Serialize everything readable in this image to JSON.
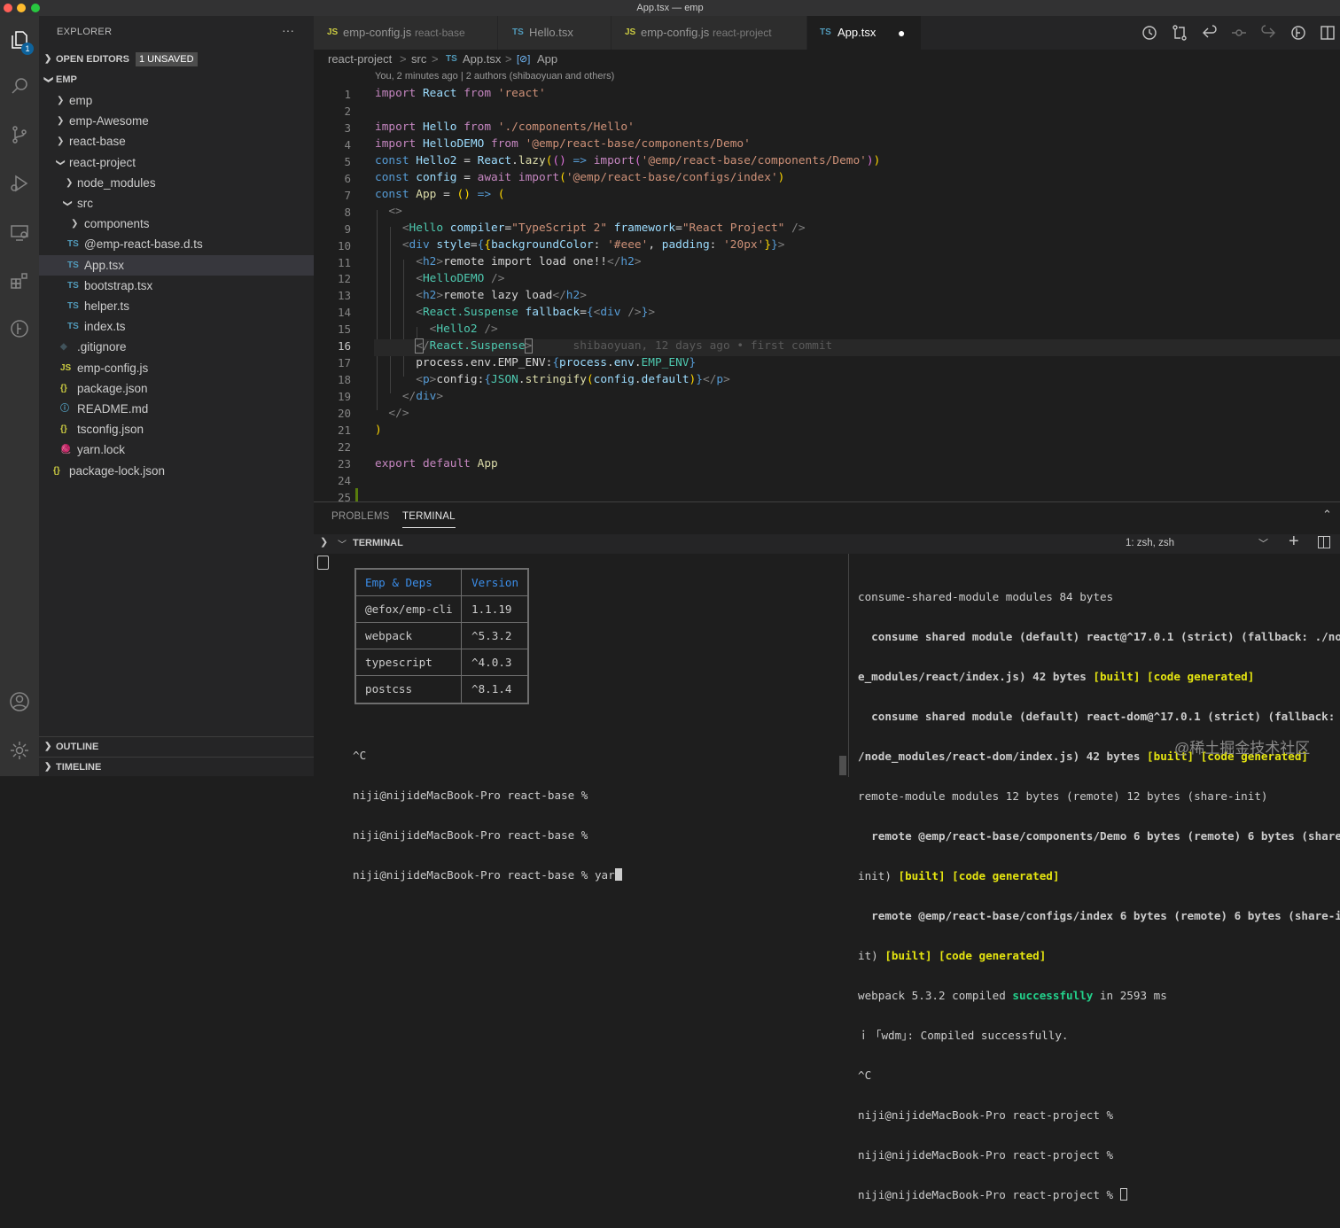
{
  "window": {
    "title": "App.tsx — emp"
  },
  "activity_bar": {
    "explorer_badge": "1"
  },
  "sidebar": {
    "title": "EXPLORER",
    "more": "···",
    "open_editors": {
      "label": "OPEN EDITORS",
      "badge": "1 UNSAVED"
    },
    "root": "EMP",
    "tree": [
      {
        "name": "emp",
        "icon": "",
        "kind": "folder",
        "expanded": false
      },
      {
        "name": "emp-Awesome",
        "icon": "",
        "kind": "folder",
        "expanded": false
      },
      {
        "name": "react-base",
        "icon": "",
        "kind": "folder",
        "expanded": false
      },
      {
        "name": "react-project",
        "icon": "",
        "kind": "folder",
        "expanded": true
      },
      {
        "name": "node_modules",
        "icon": "",
        "kind": "folder",
        "expanded": false
      },
      {
        "name": "src",
        "icon": "",
        "kind": "folder",
        "expanded": true
      },
      {
        "name": "components",
        "icon": "",
        "kind": "folder",
        "expanded": false
      },
      {
        "name": "@emp-react-base.d.ts",
        "icon": "TS",
        "kind": "ts"
      },
      {
        "name": "App.tsx",
        "icon": "TS",
        "kind": "ts",
        "selected": true
      },
      {
        "name": "bootstrap.tsx",
        "icon": "TS",
        "kind": "ts"
      },
      {
        "name": "helper.ts",
        "icon": "TS",
        "kind": "ts"
      },
      {
        "name": "index.ts",
        "icon": "TS",
        "kind": "ts"
      },
      {
        "name": ".gitignore",
        "icon": "◆",
        "kind": "git"
      },
      {
        "name": "emp-config.js",
        "icon": "JS",
        "kind": "js"
      },
      {
        "name": "package.json",
        "icon": "{}",
        "kind": "json"
      },
      {
        "name": "README.md",
        "icon": "ⓘ",
        "kind": "info"
      },
      {
        "name": "tsconfig.json",
        "icon": "{}",
        "kind": "json"
      },
      {
        "name": "yarn.lock",
        "icon": "🧶",
        "kind": "yarn"
      },
      {
        "name": "package-lock.json",
        "icon": "{}",
        "kind": "json"
      }
    ],
    "outline": "OUTLINE",
    "timeline": "TIMELINE"
  },
  "tabs": [
    {
      "icon": "JS",
      "name": "emp-config.js",
      "desc": "react-base"
    },
    {
      "icon": "TS",
      "name": "Hello.tsx",
      "desc": ""
    },
    {
      "icon": "JS",
      "name": "emp-config.js",
      "desc": "react-project"
    },
    {
      "icon": "TS",
      "name": "App.tsx",
      "desc": "",
      "active": true,
      "dirty": "●"
    }
  ],
  "breadcrumb": [
    "react-project",
    ">",
    "src",
    ">",
    "TS",
    "App.tsx",
    ">",
    "[⊘]",
    "App"
  ],
  "blame_header": "You, 2 minutes ago | 2 authors (shibaoyuan and others)",
  "inline_blame": "shibaoyuan, 12 days ago • first commit",
  "line_numbers": [
    "1",
    "2",
    "3",
    "4",
    "5",
    "6",
    "7",
    "8",
    "9",
    "10",
    "11",
    "12",
    "13",
    "14",
    "15",
    "16",
    "17",
    "18",
    "19",
    "20",
    "21",
    "22",
    "23",
    "24",
    "25"
  ],
  "panel": {
    "tabs": [
      "PROBLEMS",
      "TERMINAL"
    ],
    "terminal_label": "TERMINAL",
    "terminal_selector": "1: zsh, zsh",
    "left_table": {
      "headers": [
        "Emp & Deps",
        "Version"
      ],
      "rows": [
        [
          "@efox/emp-cli",
          "1.1.19"
        ],
        [
          "webpack",
          "^5.3.2"
        ],
        [
          "typescript",
          "^4.0.3"
        ],
        [
          "postcss",
          "^8.1.4"
        ]
      ]
    },
    "left_lines": [
      "^C",
      "niji@nijideMacBook-Pro react-base %",
      "niji@nijideMacBook-Pro react-base %",
      "niji@nijideMacBook-Pro react-base % yar"
    ],
    "right_lines": [
      "consume-shared-module modules 84 bytes",
      "  consume shared module (default) react@^17.0.1 (strict) (fallback: ./nod",
      "e_modules/react/index.js) 42 bytes ",
      "  consume shared module (default) react-dom@^17.0.1 (strict) (fallback: .",
      "/node_modules/react-dom/index.js) 42 bytes ",
      "remote-module modules 12 bytes (remote) 12 bytes (share-init)",
      "  remote @emp/react-base/components/Demo 6 bytes (remote) 6 bytes (share-",
      "init) ",
      "  remote @emp/react-base/configs/index 6 bytes (remote) 6 bytes (share-in",
      "it) ",
      "webpack 5.3.2 compiled ",
      "ｉ ｢wdm｣: Compiled successfully.",
      "^C",
      "niji@nijideMacBook-Pro react-project %",
      "niji@nijideMacBook-Pro react-project %",
      "niji@nijideMacBook-Pro react-project % "
    ],
    "built_tag": "[built] [code generated]",
    "success_word": "successfully",
    "compile_time": " in 2593 ms"
  },
  "watermark": "@稀土掘金技术社区",
  "colors": {
    "accent": "#0e639c",
    "editor_bg": "#1e1e1e",
    "sidebar_bg": "#252526",
    "activity_bg": "#333333"
  }
}
